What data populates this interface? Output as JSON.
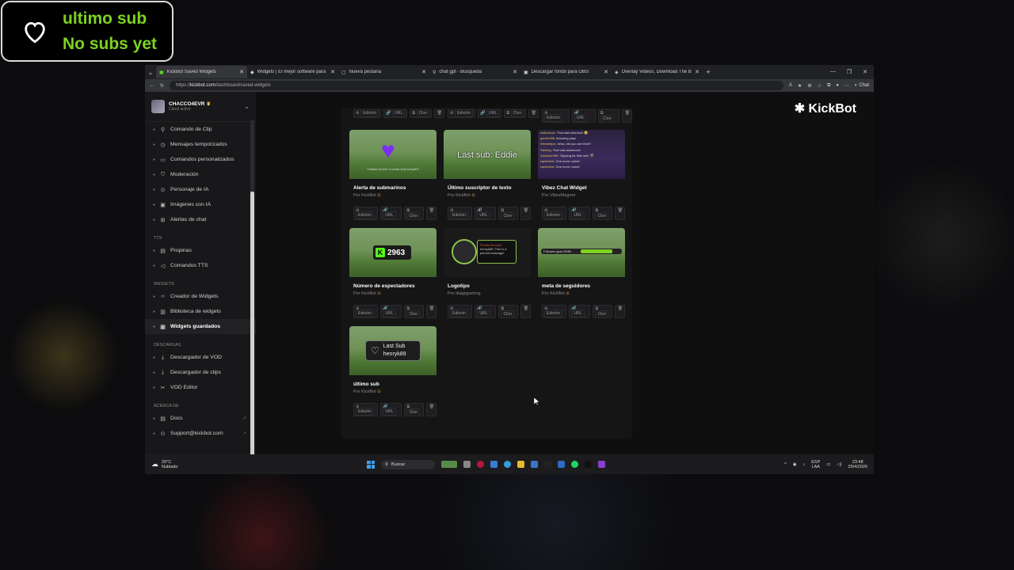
{
  "overlay": {
    "line1": "ultimo sub",
    "line2": "No subs yet"
  },
  "browser": {
    "tabs": [
      {
        "label": "KickBot Saved Widgets",
        "active": true
      },
      {
        "label": "Widgets | El mejor software para p",
        "active": false
      },
      {
        "label": "Nueva pestaña",
        "active": false
      },
      {
        "label": "chat gpt - Búsqueda",
        "active": false
      },
      {
        "label": "Descargar fondo para OBS",
        "active": false
      },
      {
        "label": "Overlay Videos, Download The Bes",
        "active": false
      }
    ],
    "url_prefix": "https://",
    "url_host": "kickbot.com",
    "url_path": "/dashboard/saved-widgets",
    "chat_label": "Chat"
  },
  "channel": {
    "name": "CHACCO4EVR",
    "subtitle": "Canal activo"
  },
  "brand": "KickBot",
  "sidebar": {
    "top_items": [
      {
        "label": "Comando de Clip",
        "icon": "pin-icon"
      },
      {
        "label": "Mensajes temporizados",
        "icon": "timer-icon"
      },
      {
        "label": "Comandos personalizados",
        "icon": "terminal-icon"
      },
      {
        "label": "Moderación",
        "icon": "shield-icon"
      },
      {
        "label": "Personaje de IA",
        "icon": "ai-icon"
      },
      {
        "label": "Imágenes con IA",
        "icon": "image-icon"
      },
      {
        "label": "Alertas de chat",
        "icon": "gift-icon"
      }
    ],
    "sections": [
      {
        "title": "TTS",
        "items": [
          {
            "label": "Propinas",
            "icon": "tip-icon"
          },
          {
            "label": "Comandos TTS",
            "icon": "speaker-icon"
          }
        ]
      },
      {
        "title": "WIDGETS",
        "items": [
          {
            "label": "Creador de Widgets",
            "icon": "code-icon"
          },
          {
            "label": "Biblioteca de widgets",
            "icon": "library-icon"
          },
          {
            "label": "Widgets guardados",
            "icon": "saved-icon",
            "active": true
          }
        ]
      },
      {
        "title": "DESCARGAS",
        "items": [
          {
            "label": "Descargador de VOD",
            "icon": "download-icon"
          },
          {
            "label": "Descargador de clips",
            "icon": "clip-icon"
          },
          {
            "label": "VOD Editor",
            "icon": "editor-icon"
          }
        ]
      },
      {
        "title": "ACERCA DE",
        "items": [
          {
            "label": "Docs",
            "icon": "docs-icon",
            "external": true
          },
          {
            "label": "Support@kickbot.com",
            "icon": "mail-icon",
            "external": true
          }
        ]
      }
    ]
  },
  "card_actions": {
    "edit": "Edición",
    "url": "URL",
    "clone": "Clon"
  },
  "widgets": [
    {
      "title": "Alerta de submarinos",
      "by": "Por KickBot",
      "verified": true,
      "thumb_text": "Thanks for the 1 month sub henry89!"
    },
    {
      "title": "Último suscriptor de texto",
      "by": "Por KickBot",
      "verified": true,
      "thumb_text": "Last sub: Eddie"
    },
    {
      "title": "Vibez Chat Widget",
      "by": "Por VibezMagnet",
      "verified": false,
      "thumb_lines": [
        [
          "ballerdude:",
          "That was hilarious! 😂"
        ],
        [
          "gamer456:",
          "Amazing play!"
        ],
        [
          "Weedlejuic:",
          "Wow, did you see that?!"
        ],
        [
          "Sterling:",
          "That was awesome!"
        ],
        [
          "Sascha1995:",
          "Clipping for that one! 🎬"
        ],
        [
          "raptorbird:",
          "One more round!"
        ],
        [
          "raptorbird:",
          "One more round!"
        ]
      ]
    },
    {
      "title": "Número de espectadores",
      "by": "Por KickBot",
      "verified": true,
      "thumb_text": "2963"
    },
    {
      "title": "Logotipo",
      "by": "Por diagpgaming",
      "verified": false,
      "thumb_name": "Florida Branner",
      "thumb_text": "henryk89: This is a pinned message!"
    },
    {
      "title": "meta de seguidores",
      "by": "Por KickBot",
      "verified": true,
      "thumb_text": "Follower goal 29/80"
    },
    {
      "title": "último sub",
      "by": "Por KickBot",
      "verified": true,
      "thumb_line1": "Last Sub",
      "thumb_line2": "henryk89"
    }
  ],
  "taskbar": {
    "temp": "20°C",
    "weather": "Nublado",
    "search": "Buscar",
    "lang1": "ESP",
    "lang2": "LAA",
    "time": "23:48",
    "date": "25/4/2026"
  }
}
